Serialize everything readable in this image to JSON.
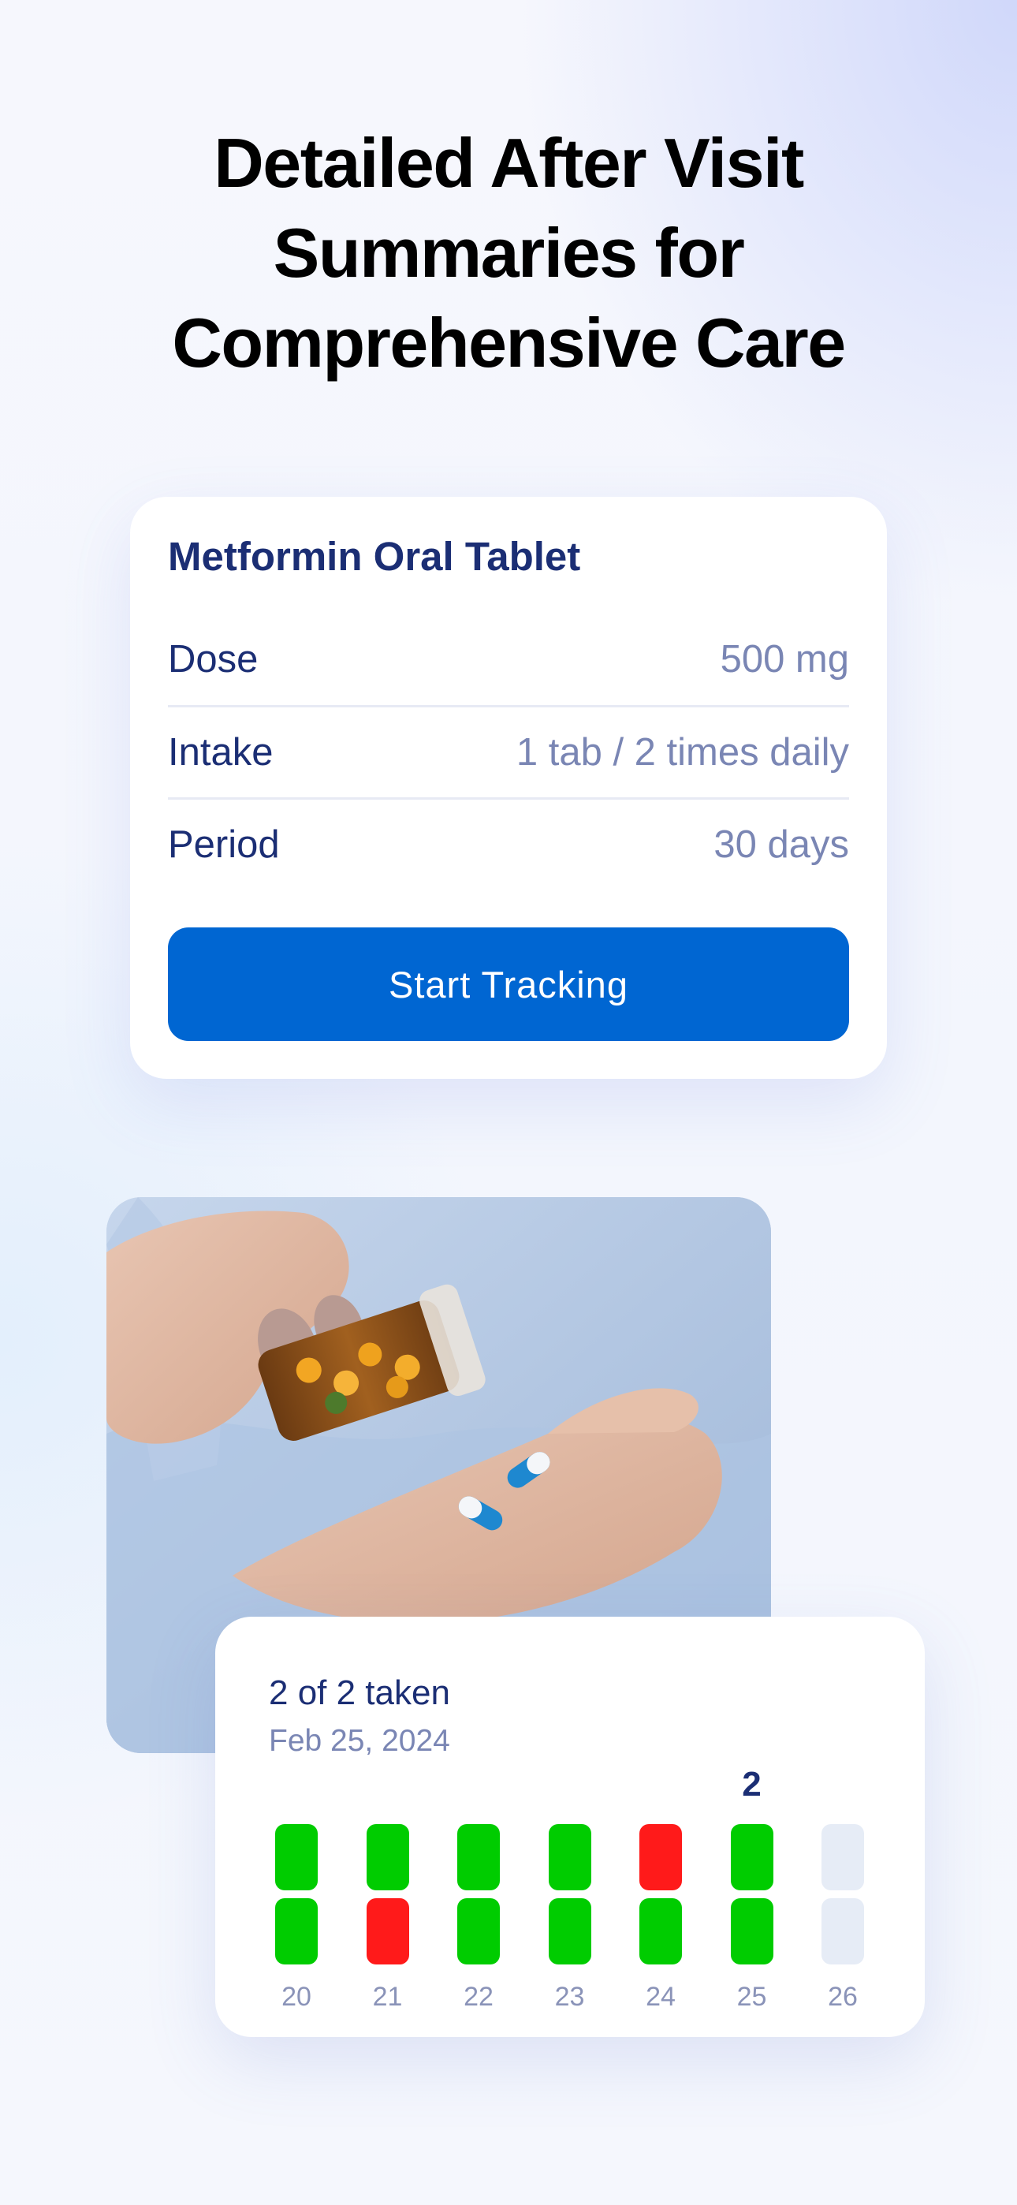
{
  "headline": {
    "line1": "Detailed After Visit",
    "line2": "Summaries for",
    "line3": "Comprehensive Care"
  },
  "medication": {
    "name": "Metformin Oral Tablet",
    "rows": [
      {
        "label": "Dose",
        "value": "500 mg"
      },
      {
        "label": "Intake",
        "value": "1 tab / 2 times daily"
      },
      {
        "label": "Period",
        "value": "30 days"
      }
    ],
    "button_label": "Start Tracking"
  },
  "tracker": {
    "status": "2 of 2 taken",
    "date": "Feb 25, 2024",
    "selected_count": "2",
    "days": [
      {
        "label": "20",
        "doses": [
          "taken",
          "taken"
        ]
      },
      {
        "label": "21",
        "doses": [
          "taken",
          "missed"
        ]
      },
      {
        "label": "22",
        "doses": [
          "taken",
          "taken"
        ]
      },
      {
        "label": "23",
        "doses": [
          "taken",
          "taken"
        ]
      },
      {
        "label": "24",
        "doses": [
          "missed",
          "taken"
        ]
      },
      {
        "label": "25",
        "doses": [
          "taken",
          "taken"
        ]
      },
      {
        "label": "26",
        "doses": [
          "pending",
          "pending"
        ]
      }
    ],
    "selected_day_index": 5
  },
  "colors": {
    "taken": "#00cc00",
    "missed": "#ff1a1a",
    "pending": "#e6ecf6",
    "primary_button": "#0066d2",
    "navy_text": "#1b2e74",
    "muted_text": "#7a86b4"
  },
  "icons": {
    "photo": "hand-pouring-pills-photo"
  }
}
